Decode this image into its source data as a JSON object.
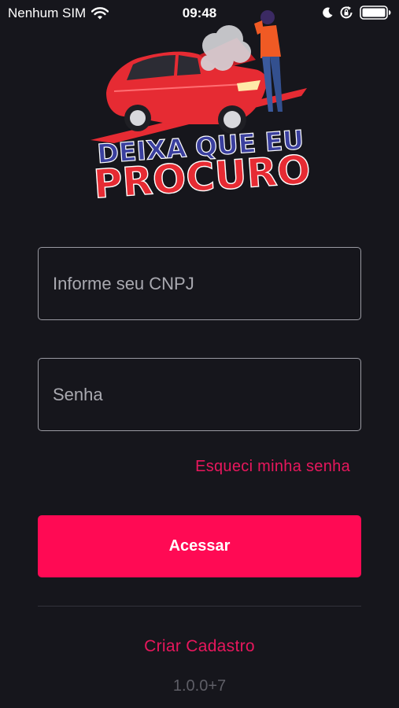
{
  "statusbar": {
    "carrier": "Nenhum SIM",
    "time": "09:48",
    "icons": [
      "wifi-icon",
      "moon-icon",
      "rotation-lock-icon",
      "battery-icon"
    ]
  },
  "logo": {
    "line1": "DEIXA QUE EU",
    "line2": "PROCURO",
    "colors": {
      "red": "#e62b33",
      "blue": "#3a3f9e"
    }
  },
  "form": {
    "cnpj_placeholder": "Informe seu CNPJ",
    "password_placeholder": "Senha",
    "forgot_label": "Esqueci minha senha",
    "submit_label": "Acessar"
  },
  "footer": {
    "create_label": "Criar Cadastro",
    "version": "1.0.0+7"
  },
  "theme": {
    "background": "#16161c",
    "accent": "#ff0a54",
    "link": "#e8175d"
  }
}
